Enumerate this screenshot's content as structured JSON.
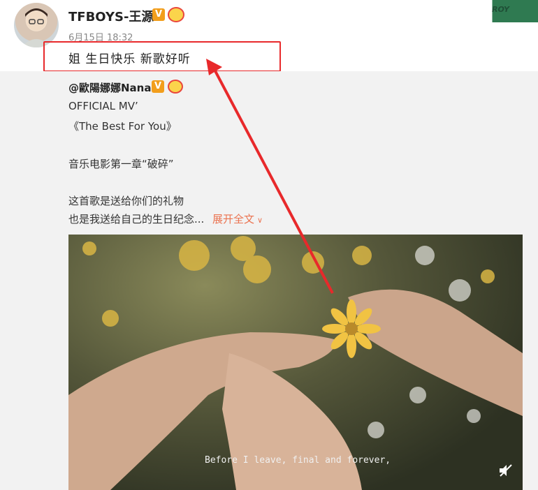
{
  "post": {
    "username": "TFBOYS-王源",
    "verified_badge": "V",
    "date": "6月15日 18:32",
    "text": "姐 生日快乐 新歌好听",
    "corner_logo_text": "ROY"
  },
  "repost": {
    "author": "@歐陽娜娜Nana",
    "verified_badge": "V",
    "lines": [
      "OFFICIAL MV’",
      "《The Best For You》",
      "音乐电影第一章“破碎”",
      "这首歌是送给你们的礼物",
      "也是我送给自己的生日纪念..."
    ],
    "expand_label": "展开全文",
    "expand_icon": "chevron-down-icon"
  },
  "video": {
    "subtitle": "Before I leave, final and forever,",
    "mute_icon": "mute-icon"
  },
  "colors": {
    "highlight": "#e8292b",
    "expand": "#eb7350",
    "badge": "#f29e1c"
  }
}
